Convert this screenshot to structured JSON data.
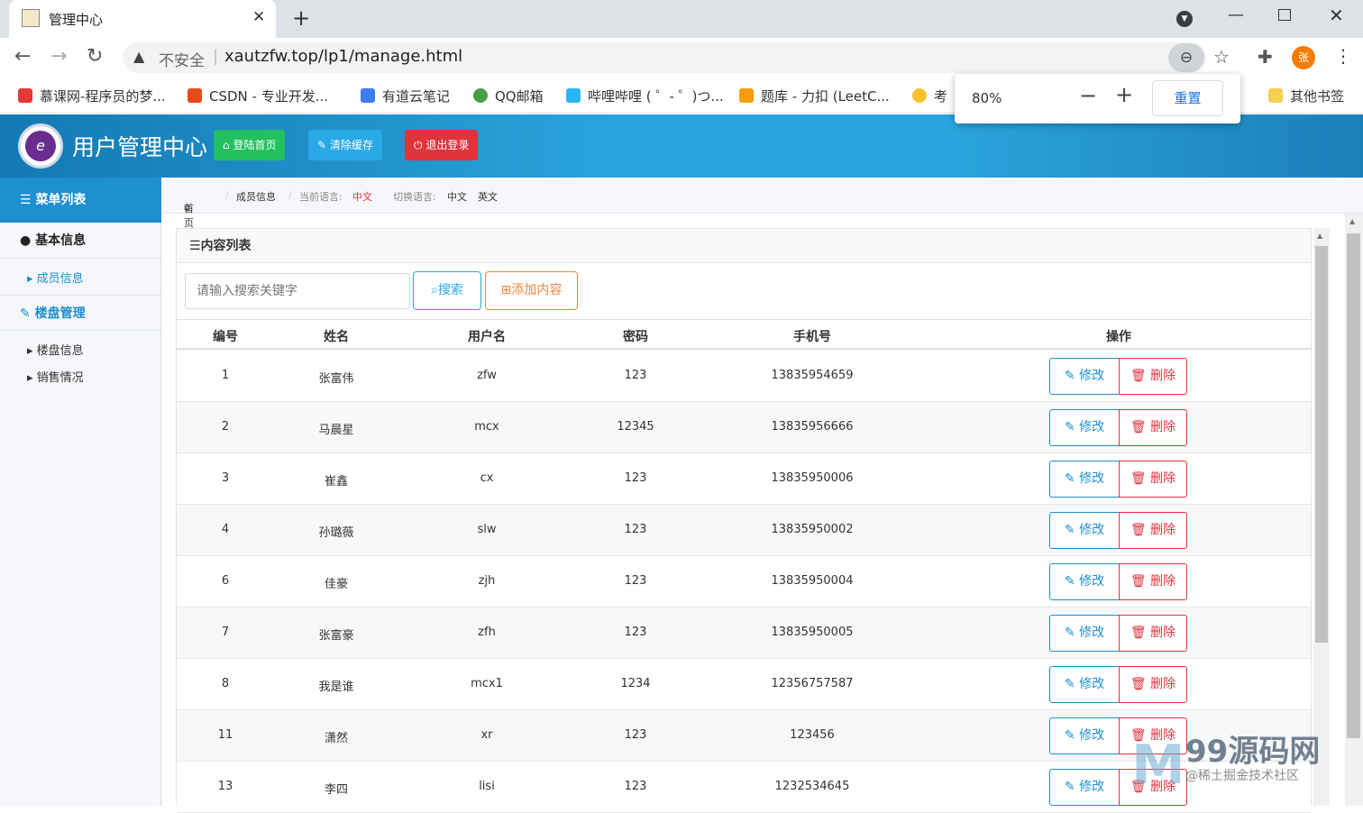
{
  "browser": {
    "tab_title": "管理中心",
    "tab_close": "✕",
    "new_tab": "+",
    "insecure_label": "不安全",
    "url": "xautzfw.top/lp1/manage.html",
    "profile_initial": "张",
    "bookmarks": [
      {
        "label": "慕课网-程序员的梦...",
        "color": "#e53935"
      },
      {
        "label": "CSDN - 专业开发...",
        "color": "#e64a19"
      },
      {
        "label": "有道云笔记",
        "color": "#3f7cf0"
      },
      {
        "label": "QQ邮箱",
        "color": "#43a047"
      },
      {
        "label": "哔哩哔哩 ( ゜- ゜)つ...",
        "color": "#29b6f6"
      },
      {
        "label": "题库 - 力扣 (LeetC...",
        "color": "#f59e0b"
      },
      {
        "label": "考",
        "color": "#fbc02d"
      }
    ],
    "other_bookmarks": "其他书签",
    "zoom": {
      "value": "80%",
      "minus": "−",
      "plus": "+",
      "reset": "重置"
    }
  },
  "header": {
    "title": "用户管理中心",
    "logo_text": "e",
    "buttons": [
      {
        "label": "登陆首页",
        "icon": "home-icon",
        "color": "#22c05f"
      },
      {
        "label": "清除缓存",
        "icon": "wrench-icon",
        "color": "#29a9e6"
      },
      {
        "label": "退出登录",
        "icon": "power-icon",
        "color": "#e0333c"
      }
    ]
  },
  "sidebar": {
    "menu_title": "菜单列表",
    "groups": [
      {
        "label": "基本信息",
        "items": [
          "成员信息"
        ]
      },
      {
        "label": "楼盘管理",
        "items": [
          "楼盘信息",
          "销售情况"
        ]
      }
    ]
  },
  "breadcrumb": {
    "home": "首页",
    "current": "成员信息",
    "lang_label": "当前语言:",
    "lang_value": "中文",
    "switch_label": "切换语言:",
    "lang_zh": "中文",
    "lang_en": "英文"
  },
  "content": {
    "panel_title": "内容列表",
    "search_placeholder": "请输入搜索关键字",
    "search_button": "搜索",
    "add_button": "添加内容",
    "columns": [
      "编号",
      "姓名",
      "用户名",
      "密码",
      "手机号",
      "操作"
    ],
    "edit_label": "修改",
    "delete_label": "删除",
    "rows": [
      {
        "id": "1",
        "name": "张富伟",
        "username": "zfw",
        "password": "123",
        "phone": "13835954659"
      },
      {
        "id": "2",
        "name": "马晨星",
        "username": "mcx",
        "password": "12345",
        "phone": "13835956666"
      },
      {
        "id": "3",
        "name": "崔鑫",
        "username": "cx",
        "password": "123",
        "phone": "13835950006"
      },
      {
        "id": "4",
        "name": "孙璐薇",
        "username": "slw",
        "password": "123",
        "phone": "13835950002"
      },
      {
        "id": "6",
        "name": "佳豪",
        "username": "zjh",
        "password": "123",
        "phone": "13835950004"
      },
      {
        "id": "7",
        "name": "张富豪",
        "username": "zfh",
        "password": "123",
        "phone": "13835950005"
      },
      {
        "id": "8",
        "name": "我是谁",
        "username": "mcx1",
        "password": "1234",
        "phone": "12356757587"
      },
      {
        "id": "11",
        "name": "潇然",
        "username": "xr",
        "password": "123",
        "phone": "123456"
      },
      {
        "id": "13",
        "name": "李四",
        "username": "lisi",
        "password": "123",
        "phone": "1232534645"
      }
    ]
  },
  "watermark": {
    "title": "99源码网",
    "sub": "@稀土掘金技术社区"
  }
}
